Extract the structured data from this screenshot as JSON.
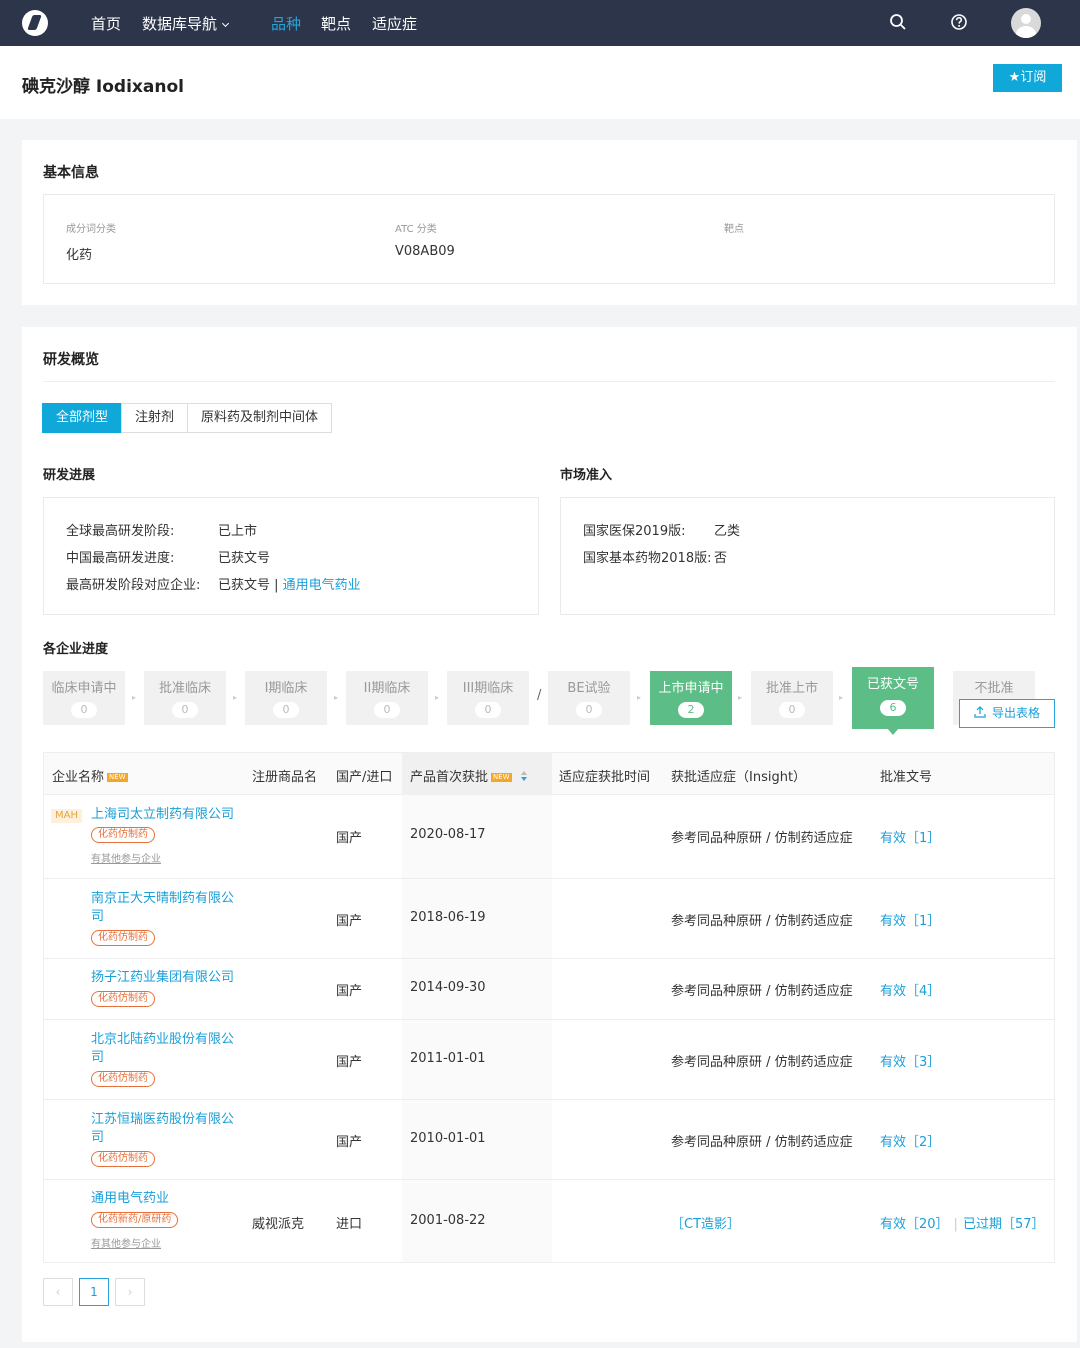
{
  "nav": {
    "items": [
      "首页",
      "数据库导航",
      "品种",
      "靶点",
      "适应症"
    ],
    "active_index": 2
  },
  "page": {
    "title": "碘克沙醇 Iodixanol",
    "subscribe_label": "★订阅"
  },
  "basic": {
    "title": "基本信息",
    "fields": [
      {
        "label": "成分词分类",
        "value": "化药"
      },
      {
        "label": "ATC 分类",
        "value": "V08AB09"
      },
      {
        "label": "靶点",
        "value": ""
      }
    ]
  },
  "rd": {
    "title": "研发概览",
    "tabs": [
      "全部剂型",
      "注射剂",
      "原料药及制剂中间体"
    ],
    "active_tab": 0,
    "progress": {
      "title": "研发进展",
      "rows": [
        {
          "label": "全球最高研发阶段:",
          "value": "已上市"
        },
        {
          "label": "中国最高研发进度:",
          "value": "已获文号"
        },
        {
          "label": "最高研发阶段对应企业:",
          "value": "已获文号 | ",
          "link": "通用电气药业"
        }
      ]
    },
    "market": {
      "title": "市场准入",
      "rows": [
        {
          "label": "国家医保2019版:",
          "value": "乙类"
        },
        {
          "label": "国家基本药物2018版:",
          "value": "否"
        }
      ]
    }
  },
  "enterprise": {
    "title": "各企业进度",
    "stages": [
      {
        "name": "临床申请中",
        "count": "0"
      },
      {
        "name": "批准临床",
        "count": "0"
      },
      {
        "name": "I期临床",
        "count": "0"
      },
      {
        "name": "II期临床",
        "count": "0"
      },
      {
        "name": "III期临床",
        "count": "0"
      },
      {
        "name": "BE试验",
        "count": "0"
      },
      {
        "name": "上市申请中",
        "count": "2"
      },
      {
        "name": "批准上市",
        "count": "0"
      },
      {
        "name": "已获文号",
        "count": "6"
      },
      {
        "name": "不批准",
        "count": ""
      }
    ],
    "separator": "/",
    "export_label": "导出表格"
  },
  "table": {
    "headers": [
      "企业名称",
      "注册商品名",
      "国产/进口",
      "产品首次获批",
      "适应症获批时间",
      "获批适应症（Insight）",
      "批准文号"
    ],
    "new_tag": "NEW",
    "rows": [
      {
        "mah": "MAH",
        "company": "上海司太立制药有限公司",
        "tag": "化药仿制药",
        "more": "有其他参与企业",
        "brand": "",
        "origin": "国产",
        "date": "2020-08-17",
        "ind_time": "",
        "indication": "参考同品种原研 / 仿制药适应症",
        "approval": "有效［1］",
        "expired": ""
      },
      {
        "mah": "",
        "company": "南京正大天晴制药有限公司",
        "tag": "化药仿制药",
        "more": "",
        "brand": "",
        "origin": "国产",
        "date": "2018-06-19",
        "ind_time": "",
        "indication": "参考同品种原研 / 仿制药适应症",
        "approval": "有效［1］",
        "expired": ""
      },
      {
        "mah": "",
        "company": "扬子江药业集团有限公司",
        "tag": "化药仿制药",
        "more": "",
        "brand": "",
        "origin": "国产",
        "date": "2014-09-30",
        "ind_time": "",
        "indication": "参考同品种原研 / 仿制药适应症",
        "approval": "有效［4］",
        "expired": ""
      },
      {
        "mah": "",
        "company": "北京北陆药业股份有限公司",
        "tag": "化药仿制药",
        "more": "",
        "brand": "",
        "origin": "国产",
        "date": "2011-01-01",
        "ind_time": "",
        "indication": "参考同品种原研 / 仿制药适应症",
        "approval": "有效［3］",
        "expired": ""
      },
      {
        "mah": "",
        "company": "江苏恒瑞医药股份有限公司",
        "tag": "化药仿制药",
        "more": "",
        "brand": "",
        "origin": "国产",
        "date": "2010-01-01",
        "ind_time": "",
        "indication": "参考同品种原研 / 仿制药适应症",
        "approval": "有效［2］",
        "expired": ""
      },
      {
        "mah": "",
        "company": "通用电气药业",
        "tag": "化药新药/原研药",
        "more": "有其他参与企业",
        "brand": "威视派克",
        "origin": "进口",
        "date": "2001-08-22",
        "ind_time": "",
        "indication": "［CT造影］",
        "approval": "有效［20］",
        "expired": "已过期［57］"
      }
    ]
  },
  "pagination": {
    "prev": "‹",
    "current": "1",
    "next": "›"
  },
  "colors": {
    "nav_bg": "#2c3549",
    "accent": "#10a7d9",
    "green": "#5dbd86",
    "tag_orange": "#e8703a"
  }
}
